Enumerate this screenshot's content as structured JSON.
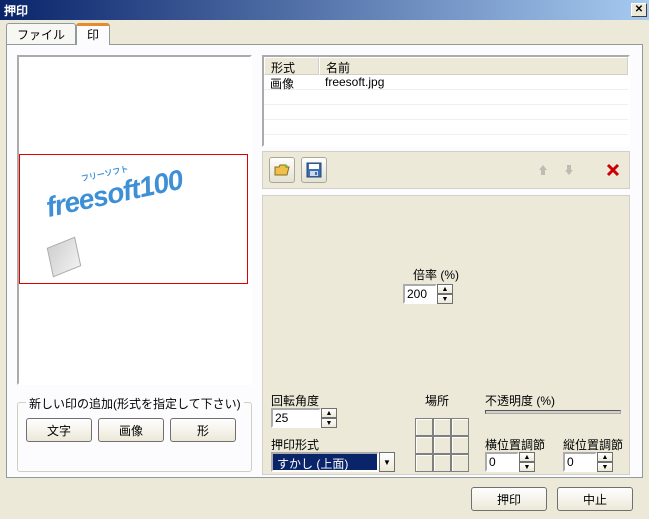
{
  "window": {
    "title": "押印"
  },
  "tabs": {
    "file": "ファイル",
    "stamp": "印"
  },
  "preview": {
    "logo_main": "freesoft100",
    "logo_sub": "フリーソフト"
  },
  "add_group": {
    "title": "新しい印の追加(形式を指定して下さい)",
    "btn_text": "文字",
    "btn_image": "画像",
    "btn_shape": "形"
  },
  "list": {
    "col_format": "形式",
    "col_name": "名前",
    "rows": [
      {
        "format": "画像",
        "name": "freesoft.jpg"
      }
    ]
  },
  "settings": {
    "scale_label": "倍率 (%)",
    "scale_value": "200",
    "rotation_label": "回転角度",
    "rotation_value": "25",
    "stamp_format_label": "押印形式",
    "stamp_format_value": "すかし (上面)",
    "position_label": "場所",
    "opacity_label": "不透明度 (%)",
    "hpos_label": "横位置調節",
    "hpos_value": "0",
    "vpos_label": "縦位置調節",
    "vpos_value": "0"
  },
  "footer": {
    "ok": "押印",
    "cancel": "中止"
  }
}
